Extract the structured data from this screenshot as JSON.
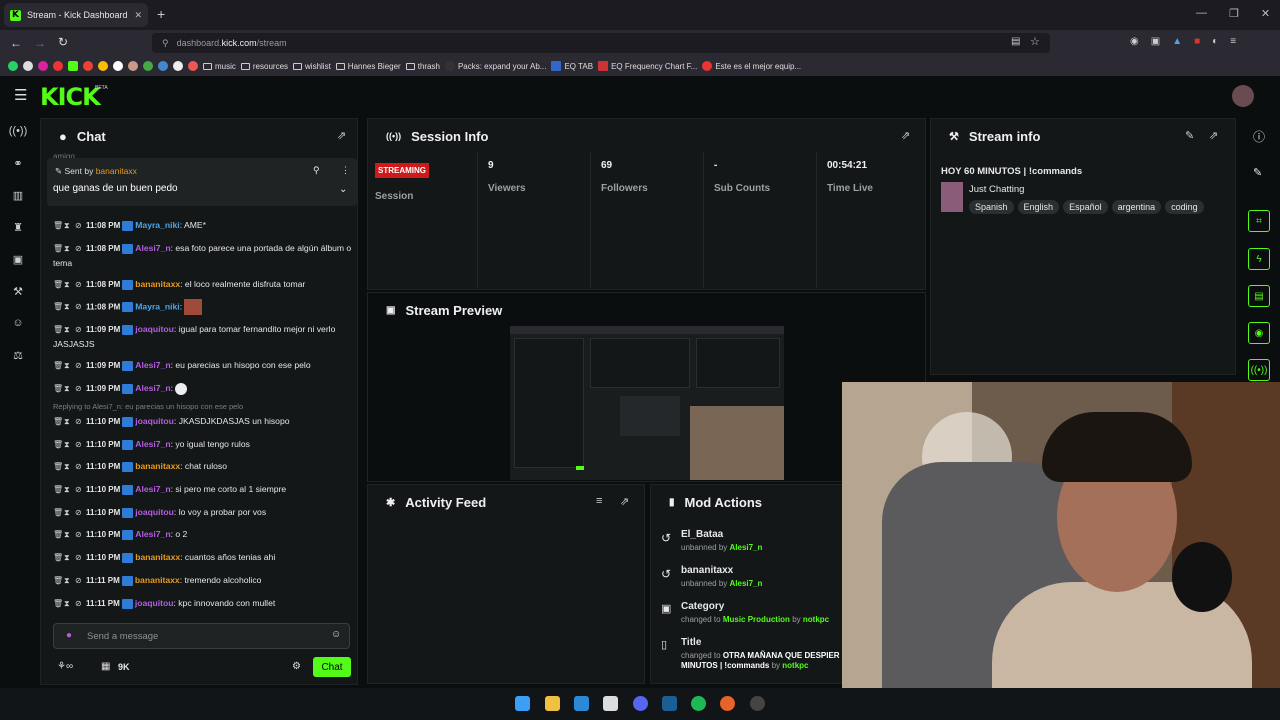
{
  "browser": {
    "tab_title": "Stream - Kick Dashboard",
    "new_tab": "+",
    "url_prefix": "dashboard.",
    "url_domain": "kick.com",
    "url_path": "/stream",
    "window_controls": [
      "—",
      "❐",
      "✕"
    ]
  },
  "bookmarks": [
    "music",
    "resources",
    "wishlist",
    "Hannes Bieger",
    "thrash",
    "Packs: expand your Ab...",
    "EQ TAB",
    "EQ Frequency Chart F...",
    "Este es el mejor equip..."
  ],
  "kick": {
    "logo": "KICK",
    "beta": "BETA"
  },
  "chat": {
    "title": "Chat",
    "pinned_prefix": "Sent by",
    "pinned_user": "bananitaxx",
    "pinned_text": "que ganas de un buen pedo",
    "overflow_text": "amigo",
    "messages": [
      {
        "time": "11:08 PM",
        "user": "Mayra_niki",
        "color": "#4aa6e8",
        "text": ": AME*"
      },
      {
        "time": "11:08 PM",
        "user": "Alesi7_n",
        "color": "#b45de0",
        "text": ": esa foto parece una portada de algún álbum o tema"
      },
      {
        "time": "11:08 PM",
        "user": "bananitaxx",
        "color": "#e89a1c",
        "text": ": el loco realmente disfruta tomar"
      },
      {
        "time": "11:08 PM",
        "user": "Mayra_niki",
        "color": "#4aa6e8",
        "text": ":"
      },
      {
        "time": "11:09 PM",
        "user": "joaquitou",
        "color": "#b45de0",
        "text": ": igual para tomar fernandito mejor ni verlo JASJASJS"
      },
      {
        "time": "11:09 PM",
        "user": "Alesi7_n",
        "color": "#b45de0",
        "text": ": eu parecias un hisopo con ese pelo"
      },
      {
        "time": "11:09 PM",
        "user": "Alesi7_n",
        "color": "#b45de0",
        "text": ":"
      },
      {
        "time": "11:10 PM",
        "user": "joaquitou",
        "color": "#b45de0",
        "text": ": JKASDJKDASJAS un hisopo"
      },
      {
        "time": "11:10 PM",
        "user": "Alesi7_n",
        "color": "#b45de0",
        "text": ": yo igual tengo rulos"
      },
      {
        "time": "11:10 PM",
        "user": "bananitaxx",
        "color": "#e89a1c",
        "text": ": chat ruloso"
      },
      {
        "time": "11:10 PM",
        "user": "Alesi7_n",
        "color": "#b45de0",
        "text": ": si pero me corto al 1 siempre"
      },
      {
        "time": "11:10 PM",
        "user": "joaquitou",
        "color": "#b45de0",
        "text": ": lo voy a probar por vos"
      },
      {
        "time": "11:10 PM",
        "user": "Alesi7_n",
        "color": "#b45de0",
        "text": ": o 2"
      },
      {
        "time": "11:10 PM",
        "user": "bananitaxx",
        "color": "#e89a1c",
        "text": ": cuantos años tenias ahi"
      },
      {
        "time": "11:11 PM",
        "user": "bananitaxx",
        "color": "#e89a1c",
        "text": ": tremendo alcoholico"
      },
      {
        "time": "11:11 PM",
        "user": "joaquitou",
        "color": "#b45de0",
        "text": ": kpc innovando con mullet"
      }
    ],
    "reply_note": "Replying to Alesi7_n: eu parecias un hisopo con ese pelo",
    "input_placeholder": "Send a message",
    "viewer_count": "9K",
    "chat_button": "Chat"
  },
  "session": {
    "title": "Session Info",
    "status": "STREAMING",
    "status_label": "Session",
    "stats": [
      {
        "value": "9",
        "label": "Viewers"
      },
      {
        "value": "69",
        "label": "Followers"
      },
      {
        "value": "-",
        "label": "Sub Counts"
      },
      {
        "value": "00:54:21",
        "label": "Time Live"
      }
    ]
  },
  "preview": {
    "title": "Stream Preview"
  },
  "activity": {
    "title": "Activity Feed"
  },
  "mod_actions": {
    "title": "Mod Actions",
    "items": [
      {
        "name": "El_Bataa",
        "action": "unbanned by",
        "by": "Alesi7_n"
      },
      {
        "name": "bananitaxx",
        "action": "unbanned by",
        "by": "Alesi7_n"
      },
      {
        "name": "Category",
        "action": "changed to",
        "value": "Music Production",
        "sep": "by",
        "by": "notkpc"
      },
      {
        "name": "Title",
        "action": "changed to",
        "value": "OTRA MAÑANA QUE DESPIER MINUTOS | !commands",
        "sep": "by",
        "by": "notkpc"
      }
    ]
  },
  "stream_info": {
    "title": "Stream info",
    "stream_title": "HOY 60 MINUTOS | !commands",
    "category": "Just Chatting",
    "tags": [
      "Spanish",
      "English",
      "Español",
      "argentina",
      "coding"
    ]
  },
  "colors": {
    "accent": "#53fc18",
    "streaming": "#d01a1a"
  }
}
